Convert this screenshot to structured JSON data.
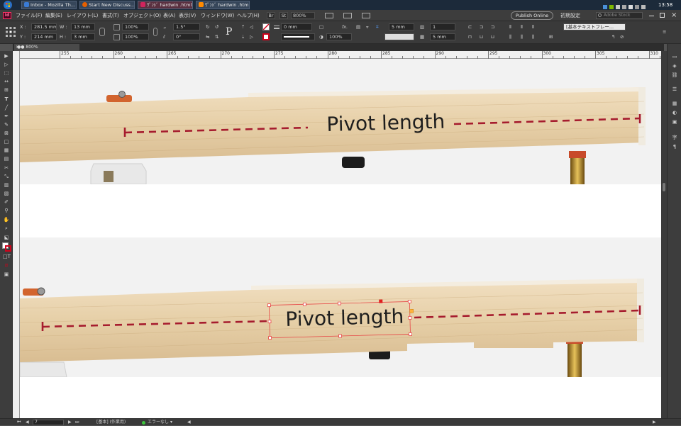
{
  "taskbar": {
    "tasks": [
      "Inbox - Mozilla Th...",
      "Start New Discuss...",
      "ﾜﾟﾝﾄﾞ hardwin .html...",
      "ﾜﾟﾝﾄﾞ hardwin .html..."
    ],
    "clock": "13:58"
  },
  "menubar": {
    "items": [
      "ファイル(F)",
      "編集(E)",
      "レイアウト(L)",
      "書式(T)",
      "オブジェクト(O)",
      "表(A)",
      "表示(V)",
      "ウィンドウ(W)",
      "ヘルプ(H)"
    ],
    "br_label": "Br",
    "st_label": "St",
    "zoom": "800%",
    "publish_label": "Publish Online",
    "workspace": "初期設定",
    "search_placeholder": "Adobe Stock"
  },
  "control": {
    "x_label": "X :",
    "x_value": "281.5 mm",
    "y_label": "Y :",
    "y_value": "214 mm",
    "w_label": "W :",
    "w_value": "13 mm",
    "h_label": "H :",
    "h_value": "3 mm",
    "scale_x": "100%",
    "scale_y": "100%",
    "angle": "1.5°",
    "shear": "0°",
    "stroke_weight": "0 mm",
    "opacity": "100%",
    "col_width": "5 mm",
    "col_count": "1",
    "gutter": "5 mm",
    "style": "[基本テキストフレー..."
  },
  "document": {
    "tab_label": "●● 800%"
  },
  "ruler": {
    "labels": [
      "255",
      "260",
      "265",
      "270",
      "275",
      "280",
      "285",
      "290",
      "295",
      "300",
      "305",
      "310"
    ]
  },
  "figure": {
    "panel1_label": "Pivot length",
    "panel2_label": "Pivot length",
    "accent": "#a61c2e"
  },
  "status": {
    "page": "7",
    "master": "[基本] (作業用)",
    "errors": "エラーなし"
  }
}
